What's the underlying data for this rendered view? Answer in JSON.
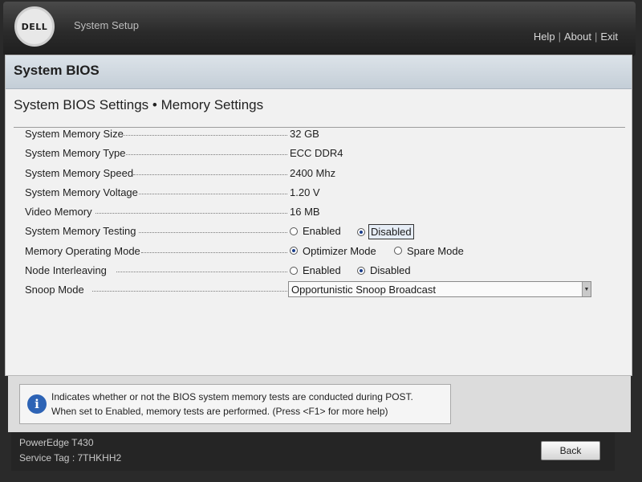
{
  "header": {
    "logo_text": "DELL",
    "app_title": "System Setup",
    "links": [
      "Help",
      "About",
      "Exit"
    ]
  },
  "section": {
    "title": "System BIOS",
    "breadcrumb": "System BIOS Settings • Memory Settings"
  },
  "settings": {
    "system_memory_size": {
      "label": "System Memory Size",
      "value": "32 GB"
    },
    "system_memory_type": {
      "label": "System Memory Type",
      "value": "ECC DDR4"
    },
    "system_memory_speed": {
      "label": "System Memory Speed",
      "value": "2400 Mhz"
    },
    "system_memory_voltage": {
      "label": "System Memory Voltage",
      "value": "1.20 V"
    },
    "video_memory": {
      "label": "Video Memory",
      "value": "16 MB"
    },
    "system_memory_testing": {
      "label": "System Memory Testing",
      "options": [
        "Enabled",
        "Disabled"
      ],
      "selected": "Disabled"
    },
    "memory_operating_mode": {
      "label": "Memory Operating Mode",
      "options": [
        "Optimizer Mode",
        "Spare Mode"
      ],
      "selected": "Optimizer Mode"
    },
    "node_interleaving": {
      "label": "Node Interleaving",
      "options": [
        "Enabled",
        "Disabled"
      ],
      "selected": "Disabled"
    },
    "snoop_mode": {
      "label": "Snoop Mode",
      "selected": "Opportunistic Snoop Broadcast"
    }
  },
  "help": {
    "line1": "Indicates whether or not the BIOS system memory tests are conducted during POST.",
    "line2": "When set to Enabled, memory tests are performed. (Press <F1> for more help)"
  },
  "footer": {
    "model": "PowerEdge T430",
    "service_tag": "Service Tag : 7THKHH2",
    "back_label": "Back"
  }
}
